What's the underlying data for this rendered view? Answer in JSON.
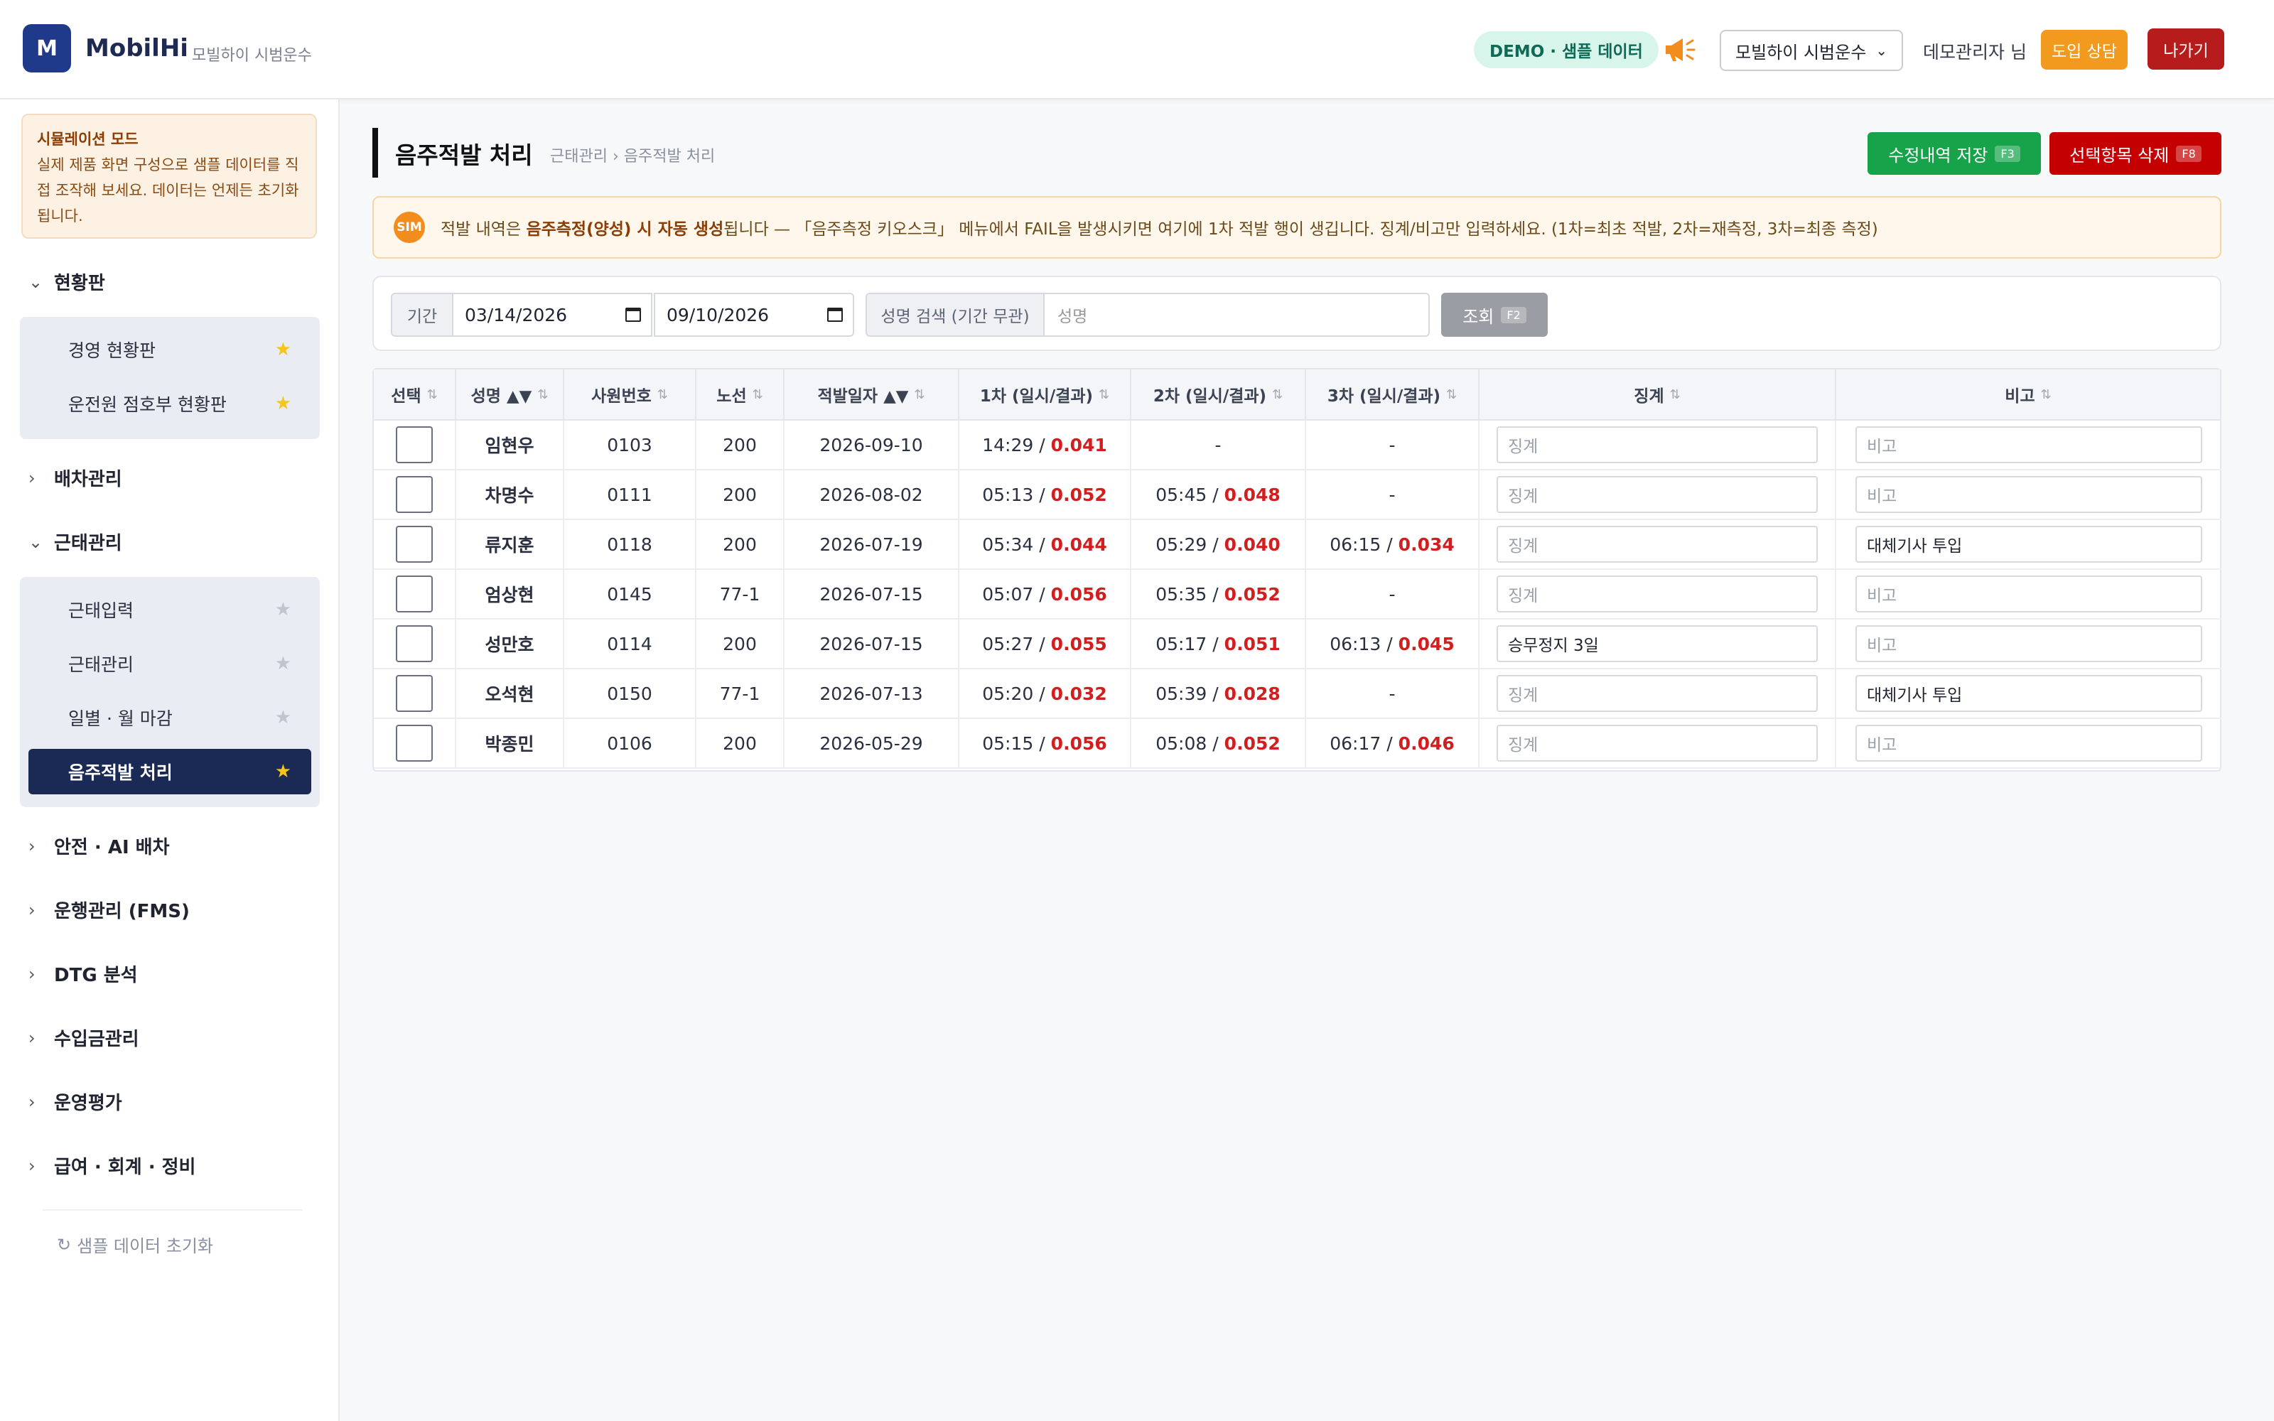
{
  "header": {
    "logo_letter": "M",
    "brand": "MobilHi",
    "brand_sub": "모빌하이 시범운수",
    "demo_badge": "DEMO · 샘플 데이터",
    "company_select": "모빌하이 시범운수",
    "user": "데모관리자 님",
    "consult_button": "도입 상담",
    "exit_button": "나가기"
  },
  "sidebar": {
    "notice_title": "시뮬레이션 모드",
    "notice_text": "실제 제품 화면 구성으로 샘플 데이터를 직접 조작해 보세요. 데이터는 언제든 초기화됩니다.",
    "groups": {
      "dashboard": "현황판",
      "dispatch": "배차관리",
      "attendance": "근태관리",
      "safety": "안전 · AI 배차",
      "fms": "운행관리 (FMS)",
      "dtg": "DTG 분석",
      "revenue": "수입금관리",
      "evaluation": "운영평가",
      "payroll": "급여 · 회계 · 정비"
    },
    "dashboard_items": [
      "경영 현황판",
      "운전원 점호부 현황판"
    ],
    "attendance_items": [
      "근태입력",
      "근태관리",
      "일별 · 월 마감",
      "음주적발 처리"
    ],
    "reset": "샘플 데이터 초기화"
  },
  "page": {
    "title": "음주적발 처리",
    "breadcrumb": "근태관리 › 음주적발 처리",
    "save_button": "수정내역 저장",
    "save_key": "F3",
    "delete_button": "선택항목 삭제",
    "delete_key": "F8",
    "banner_badge": "SIM",
    "banner_pre": "적발 내역은 ",
    "banner_bold": "음주측정(양성) 시 자동 생성",
    "banner_post": "됩니다 — 「음주측정 키오스크」 메뉴에서 FAIL을 발생시키면 여기에 1차 적발 행이 생깁니다. 징계/비고만 입력하세요. (1차=최초 적발, 2차=재측정, 3차=최종 측정)"
  },
  "filter": {
    "period_label": "기간",
    "date_from": "03/14/2026",
    "date_to": "09/10/2026",
    "name_label": "성명 검색 (기간 무관)",
    "name_placeholder": "성명",
    "search_button": "조회",
    "search_key": "F2"
  },
  "table": {
    "headers": [
      "선택",
      "성명 ▲▼",
      "사원번호",
      "노선",
      "적발일자 ▲▼",
      "1차 (일시/결과)",
      "2차 (일시/결과)",
      "3차 (일시/결과)",
      "징계",
      "비고"
    ],
    "sort_icon": "⇅",
    "discipline_placeholder": "징계",
    "remark_placeholder": "비고",
    "rows": [
      {
        "name": "임현우",
        "emp": "0103",
        "route": "200",
        "date": "2026-09-10",
        "t1": "14:29 /",
        "r1": "0.041",
        "t2": "-",
        "r2": "",
        "t3": "-",
        "r3": "",
        "discipline": "",
        "remark": ""
      },
      {
        "name": "차명수",
        "emp": "0111",
        "route": "200",
        "date": "2026-08-02",
        "t1": "05:13 /",
        "r1": "0.052",
        "t2": "05:45 /",
        "r2": "0.048",
        "t3": "-",
        "r3": "",
        "discipline": "",
        "remark": ""
      },
      {
        "name": "류지훈",
        "emp": "0118",
        "route": "200",
        "date": "2026-07-19",
        "t1": "05:34 /",
        "r1": "0.044",
        "t2": "05:29 /",
        "r2": "0.040",
        "t3": "06:15 /",
        "r3": "0.034",
        "discipline": "",
        "remark": "대체기사 투입"
      },
      {
        "name": "엄상현",
        "emp": "0145",
        "route": "77-1",
        "date": "2026-07-15",
        "t1": "05:07 /",
        "r1": "0.056",
        "t2": "05:35 /",
        "r2": "0.052",
        "t3": "-",
        "r3": "",
        "discipline": "",
        "remark": ""
      },
      {
        "name": "성만호",
        "emp": "0114",
        "route": "200",
        "date": "2026-07-15",
        "t1": "05:27 /",
        "r1": "0.055",
        "t2": "05:17 /",
        "r2": "0.051",
        "t3": "06:13 /",
        "r3": "0.045",
        "discipline": "승무정지 3일",
        "remark": ""
      },
      {
        "name": "오석현",
        "emp": "0150",
        "route": "77-1",
        "date": "2026-07-13",
        "t1": "05:20 /",
        "r1": "0.032",
        "t2": "05:39 /",
        "r2": "0.028",
        "t3": "-",
        "r3": "",
        "discipline": "",
        "remark": "대체기사 투입"
      },
      {
        "name": "박종민",
        "emp": "0106",
        "route": "200",
        "date": "2026-05-29",
        "t1": "05:15 /",
        "r1": "0.056",
        "t2": "05:08 /",
        "r2": "0.052",
        "t3": "06:17 /",
        "r3": "0.046",
        "discipline": "",
        "remark": ""
      }
    ]
  }
}
